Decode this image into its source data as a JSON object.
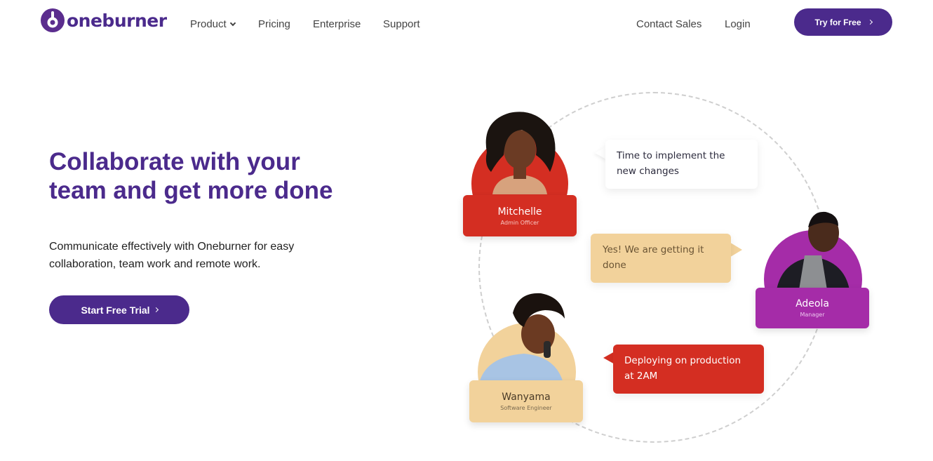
{
  "brand": {
    "name": "oneburner"
  },
  "nav": {
    "product": "Product",
    "pricing": "Pricing",
    "enterprise": "Enterprise",
    "support": "Support",
    "contact_sales": "Contact Sales",
    "login": "Login",
    "try_free": "Try for Free"
  },
  "hero": {
    "headline_line1": "Collaborate with your",
    "headline_line2": "team and get more done",
    "subtext": "Communicate effectively with Oneburner for easy collaboration, team work and remote work.",
    "cta": "Start Free Trial"
  },
  "people": [
    {
      "name": "Mitchelle",
      "role": "Admin Officer"
    },
    {
      "name": "Adeola",
      "role": "Manager"
    },
    {
      "name": "Wanyama",
      "role": "Software Engineer"
    }
  ],
  "messages": [
    {
      "text": "Time to implement the new changes"
    },
    {
      "text": "Yes! We are getting it done"
    },
    {
      "text": "Deploying on production at 2AM"
    }
  ],
  "colors": {
    "brand_purple": "#4b2a8c",
    "red": "#d42e22",
    "magenta": "#a52ca8",
    "sand": "#f2d29b"
  }
}
